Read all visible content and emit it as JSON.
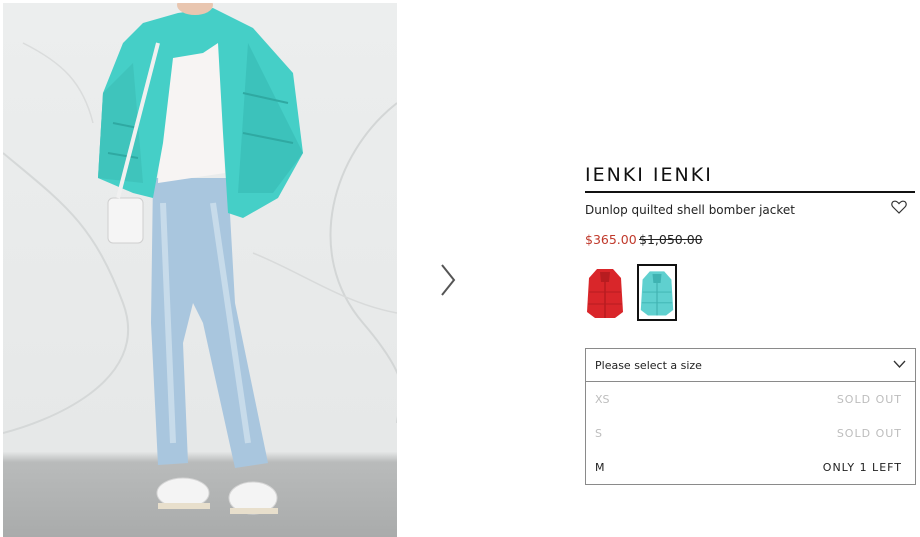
{
  "product": {
    "brand": "IENKI IENKI",
    "name": "Dunlop quilted shell bomber jacket",
    "price_current": "$365.00",
    "price_original": "$1,050.00"
  },
  "colors": {
    "accent_price": "#c0392b",
    "swatch_red": "#d9262a",
    "swatch_teal": "#5fd0cf"
  },
  "size_select": {
    "placeholder": "Please select a size",
    "options": [
      {
        "label": "XS",
        "status": "SOLD OUT"
      },
      {
        "label": "S",
        "status": "SOLD OUT"
      },
      {
        "label": "M",
        "status": "ONLY 1 LEFT"
      }
    ]
  },
  "icons": {
    "next": "chevron-right-icon",
    "wishlist": "heart-icon",
    "dropdown": "chevron-down-icon"
  }
}
